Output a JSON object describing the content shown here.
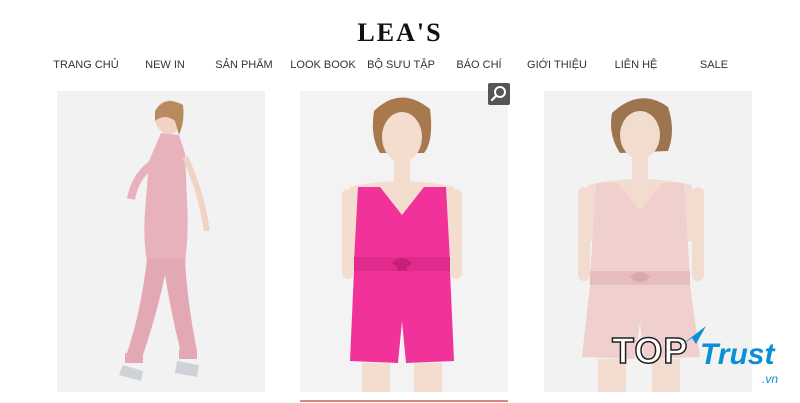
{
  "brand": {
    "logo": "LEA'S"
  },
  "nav": {
    "items": [
      "TRANG CHỦ",
      "NEW IN",
      "SẢN PHẨM",
      "LOOK BOOK",
      "BỘ SƯU TẬP",
      "BÁO CHÍ",
      "GIỚI THIỆU",
      "LIÊN HỆ",
      "SALE"
    ]
  },
  "products": [
    {
      "image": "pink-jumpsuit-photo",
      "outfit_color": "#e8b2bc"
    },
    {
      "image": "hot-pink-romper-photo",
      "outfit_color": "#f0329a"
    },
    {
      "image": "blush-romper-photo",
      "outfit_color": "#f0cfcf"
    }
  ],
  "icons": {
    "zoom": "search-icon"
  },
  "watermark": {
    "top": "TOP",
    "trust": "Trust",
    "domain": ".vn"
  },
  "colors": {
    "accent_underline": "#d48a7a",
    "watermark_blue": "#0b8fd6"
  }
}
